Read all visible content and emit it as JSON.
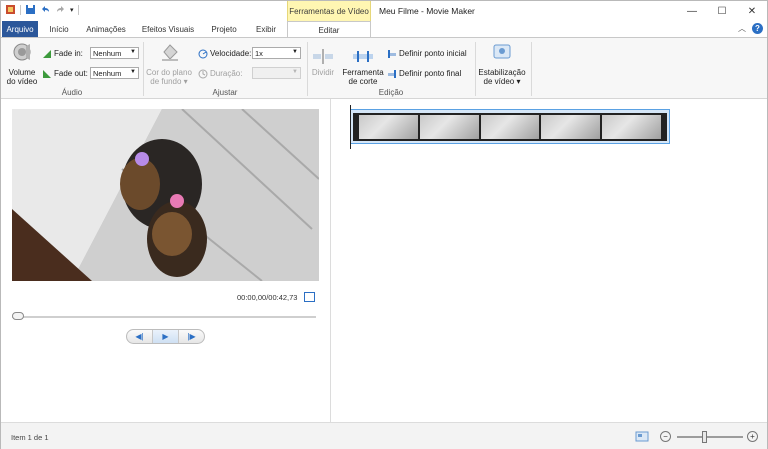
{
  "window": {
    "title": "Meu Filme - Movie Maker",
    "contextual_header": "Ferramentas de Vídeo",
    "controls": {
      "minimize": "—",
      "maximize": "☐",
      "close": "✕"
    }
  },
  "tabs": [
    {
      "label": "Arquivo",
      "active": false
    },
    {
      "label": "Início",
      "active": false
    },
    {
      "label": "Animações",
      "active": false
    },
    {
      "label": "Efeitos Visuais",
      "active": false
    },
    {
      "label": "Projeto",
      "active": false
    },
    {
      "label": "Exibir",
      "active": false
    },
    {
      "label": "Editar",
      "active": true
    }
  ],
  "ribbon": {
    "audio": {
      "label": "Áudio",
      "volume": {
        "line1": "Volume",
        "line2": "do vídeo"
      },
      "fade_in": {
        "label": "Fade in:",
        "value": "Nenhum"
      },
      "fade_out": {
        "label": "Fade out:",
        "value": "Nenhum"
      }
    },
    "adjust": {
      "label": "Ajustar",
      "background": {
        "line1": "Cor do plano",
        "line2": "de fundo ▾"
      },
      "speed": {
        "label": "Velocidade:",
        "value": "1x"
      },
      "duration": {
        "label": "Duração:",
        "value": ""
      }
    },
    "edit": {
      "label": "Edição",
      "split": "Dividir",
      "trim": {
        "line1": "Ferramenta",
        "line2": "de corte"
      },
      "set_start": "Definir ponto inicial",
      "set_end": "Definir ponto final"
    },
    "stabilization": {
      "line1": "Estabilização",
      "line2": "de vídeo ▾"
    }
  },
  "preview": {
    "timecode": "00:00,00/00:42,73",
    "progress_fraction": 0.0,
    "controls": {
      "prev": "◀|",
      "play": "▶",
      "next": "|▶"
    }
  },
  "status": {
    "item_text": "Item 1 de 1",
    "zoom_out": "−",
    "zoom_in": "+",
    "zoom_fraction": 0.4
  },
  "colors": {
    "accent": "#2b579a",
    "contextual": "#fff6b2",
    "selection": "#5aa1e3"
  }
}
